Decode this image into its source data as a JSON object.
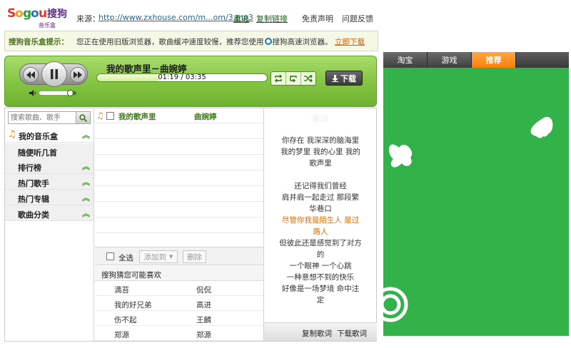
{
  "brand": {
    "logo_text": "Sogou搜狗",
    "logo_sub": "音乐盒",
    "colors": {
      "s1": "#e8322a",
      "o1": "#f39a1e",
      "g": "#2f9e3d",
      "o2": "#1e73be",
      "u": "#e8322a",
      "sou": "#5a2d82"
    }
  },
  "topbar": {
    "source_label": "来源：",
    "source_url": "http://www.zxhouse.com/m...om/3.mp3",
    "reselect": "重选",
    "copy_link": "复制链接",
    "disclaimer": "免责声明",
    "feedback": "问题反馈"
  },
  "notice": {
    "title": "搜狗音乐盒提示：",
    "text_before": "您正在使用旧版浏览器，歌曲缓冲速度较慢，推荐您使用",
    "text_after": "搜狗高速浏览器。",
    "download_link": "立即下载"
  },
  "player": {
    "song_title": "我的歌声里－曲婉婷",
    "time_display": "01:19 / 03:35",
    "progress_fraction": 0.367,
    "volume_fraction": 0.85,
    "download_label": "下载",
    "icons": {
      "prev": "prev-icon",
      "pause": "pause-icon",
      "next": "next-icon",
      "volume": "volume-icon"
    }
  },
  "sidebar": {
    "search_placeholder": "搜索歌曲、歌手",
    "items": [
      {
        "label": "我的音乐盒"
      },
      {
        "label": "随便听几首"
      },
      {
        "label": "排行榜"
      },
      {
        "label": "热门歌手"
      },
      {
        "label": "热门专辑"
      },
      {
        "label": "歌曲分类"
      }
    ]
  },
  "playlist": {
    "rows": [
      {
        "title": "我的歌声里",
        "artist": "曲婉婷"
      }
    ],
    "select_all": "全选",
    "add_to": "添加到",
    "delete": "删除"
  },
  "recommend": {
    "header": "搜狗猜您可能喜欢",
    "rows": [
      {
        "song": "満苔",
        "artist": "侃侃"
      },
      {
        "song": "我的好兄弟",
        "artist": "高进"
      },
      {
        "song": "伤不起",
        "artist": "王麟"
      },
      {
        "song": "郑源",
        "artist": "郑源"
      }
    ]
  },
  "lyrics": {
    "ghost_title": "歌词",
    "lines": [
      {
        "text": "你存在 我深深的脑海里",
        "hl": false
      },
      {
        "text": "我的梦里 我的心里 我的",
        "hl": false
      },
      {
        "text": "歌声里",
        "hl": false
      },
      {
        "text": "",
        "hl": false
      },
      {
        "text": "还记得我们曾经",
        "hl": false
      },
      {
        "text": "肩并肩一起走过 那段繁",
        "hl": false
      },
      {
        "text": "华巷口",
        "hl": false
      },
      {
        "text": "尽管你我是陌生人 是过",
        "hl": true
      },
      {
        "text": "路人",
        "hl": true
      },
      {
        "text": "但彼此还是感觉到了对方",
        "hl": false
      },
      {
        "text": "的",
        "hl": false
      },
      {
        "text": "一个眼神 一个心跳",
        "hl": false
      },
      {
        "text": "一种意想不到的快乐",
        "hl": false
      },
      {
        "text": "好像是一场梦境 命中注",
        "hl": false
      },
      {
        "text": "定",
        "hl": false
      }
    ],
    "copy": "复制歌词",
    "download": "下载歌词"
  },
  "right_panel": {
    "tabs": [
      "淘宝",
      "游戏",
      "推荐"
    ],
    "active_tab": 2,
    "ad_color": "#33b24a"
  }
}
